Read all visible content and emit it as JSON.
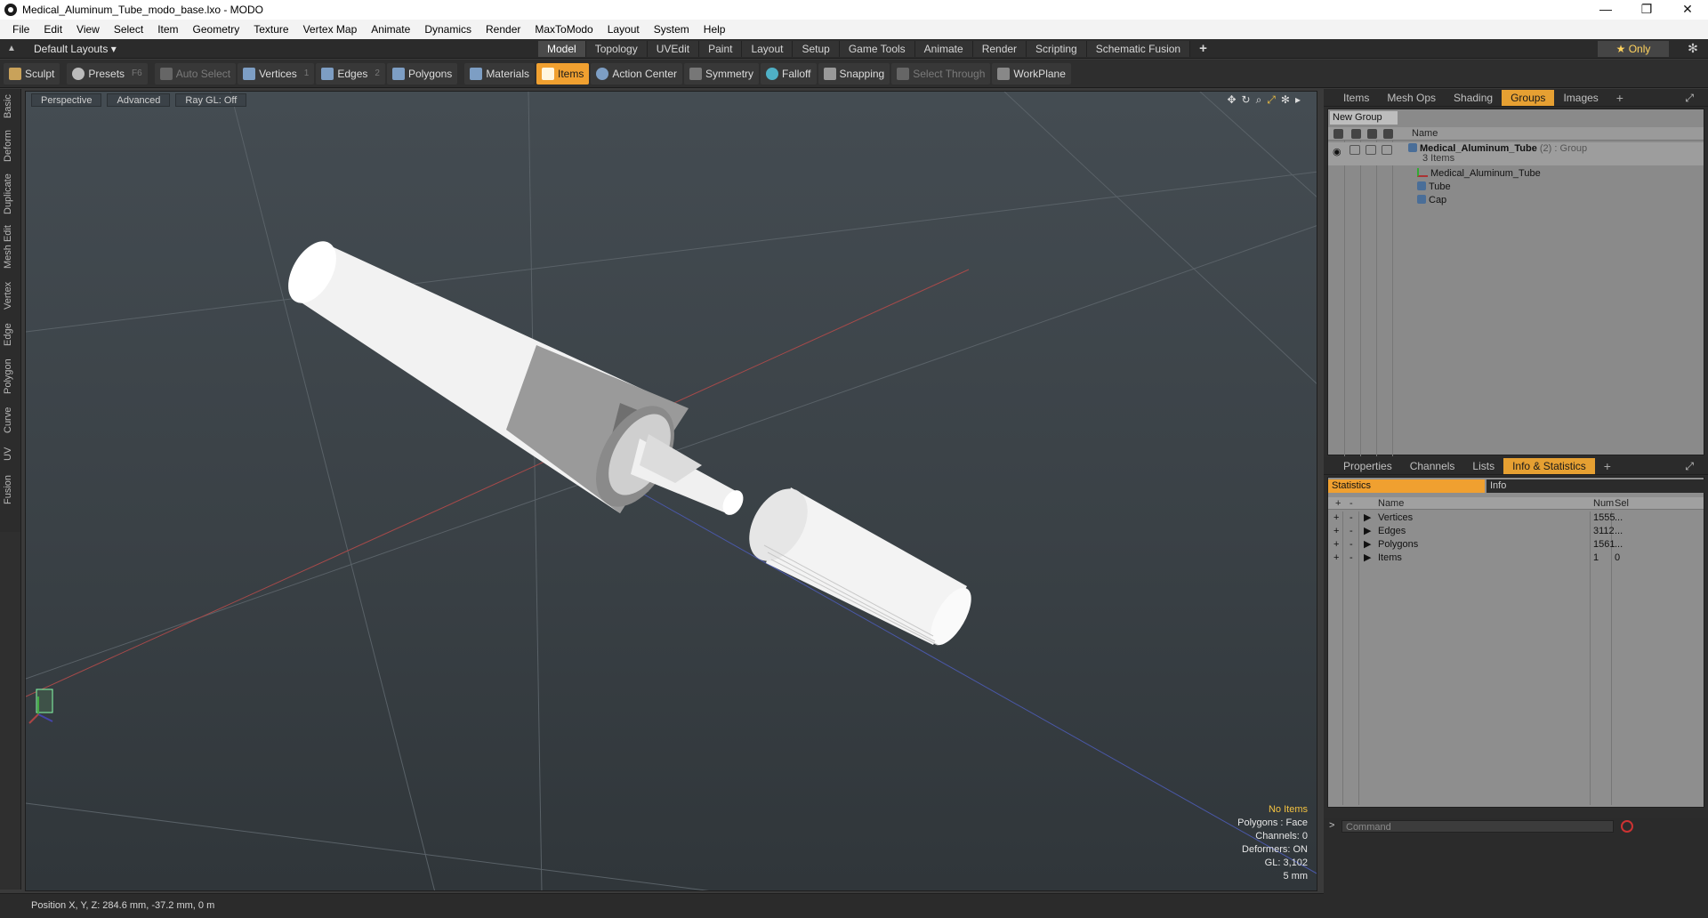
{
  "window": {
    "title": "Medical_Aluminum_Tube_modo_base.lxo - MODO",
    "min": "—",
    "max": "❐",
    "close": "✕"
  },
  "menubar": [
    "File",
    "Edit",
    "View",
    "Select",
    "Item",
    "Geometry",
    "Texture",
    "Vertex Map",
    "Animate",
    "Dynamics",
    "Render",
    "MaxToModo",
    "Layout",
    "System",
    "Help"
  ],
  "layoutbar": {
    "layout": "Default Layouts ▾",
    "tabs": [
      "Model",
      "Topology",
      "UVEdit",
      "Paint",
      "Layout",
      "Setup",
      "Game Tools",
      "Animate",
      "Render",
      "Scripting",
      "Schematic Fusion"
    ],
    "active_tab": "Model",
    "plus": "+",
    "only": "★ Only",
    "gear": "✻"
  },
  "toolbar": {
    "sculpt": "Sculpt",
    "presets": "Presets",
    "presets_key": "F6",
    "auto_select": "Auto Select",
    "vertices": "Vertices",
    "vertices_key": "1",
    "edges": "Edges",
    "edges_key": "2",
    "polygons": "Polygons",
    "materials": "Materials",
    "items": "Items",
    "action_center": "Action Center",
    "symmetry": "Symmetry",
    "falloff": "Falloff",
    "snapping": "Snapping",
    "select_through": "Select Through",
    "workplane": "WorkPlane"
  },
  "left_tabs": [
    "Basic",
    "Deform",
    "Duplicate",
    "Mesh Edit",
    "Vertex",
    "Edge",
    "Polygon",
    "Curve",
    "UV",
    "Fusion"
  ],
  "viewport": {
    "view_mode": "Perspective",
    "shading": "Advanced",
    "raygl": "Ray GL: Off",
    "info": {
      "items": "No Items",
      "polygons": "Polygons : Face",
      "channels": "Channels: 0",
      "deformers": "Deformers: ON",
      "gl": "GL: 3,102",
      "scale": "5 mm"
    }
  },
  "status": {
    "position": "Position X, Y, Z:   284.6 mm, -37.2 mm, 0 m"
  },
  "groups_panel": {
    "tabs": [
      "Items",
      "Mesh Ops",
      "Shading",
      "Groups",
      "Images"
    ],
    "active": "Groups",
    "new_group": "New Group",
    "col_name": "Name",
    "root": {
      "name": "Medical_Aluminum_Tube",
      "count": "(2)",
      "type": ": Group",
      "sub": "3 Items"
    },
    "children": [
      "Medical_Aluminum_Tube",
      "Tube",
      "Cap"
    ]
  },
  "info_panel": {
    "tabs": [
      "Properties",
      "Channels",
      "Lists",
      "Info & Statistics"
    ],
    "active": "Info & Statistics",
    "stat_tab": "Statistics",
    "info_tab": "Info",
    "cols": {
      "name": "Name",
      "num": "Num",
      "sel": "Sel"
    },
    "rows": [
      {
        "name": "Vertices",
        "num": "1555",
        "sel": "..."
      },
      {
        "name": "Edges",
        "num": "3112",
        "sel": "..."
      },
      {
        "name": "Polygons",
        "num": "1561",
        "sel": "..."
      },
      {
        "name": "Items",
        "num": "1",
        "sel": "0"
      }
    ]
  },
  "command": {
    "placeholder": "Command",
    "prompt": ">"
  }
}
